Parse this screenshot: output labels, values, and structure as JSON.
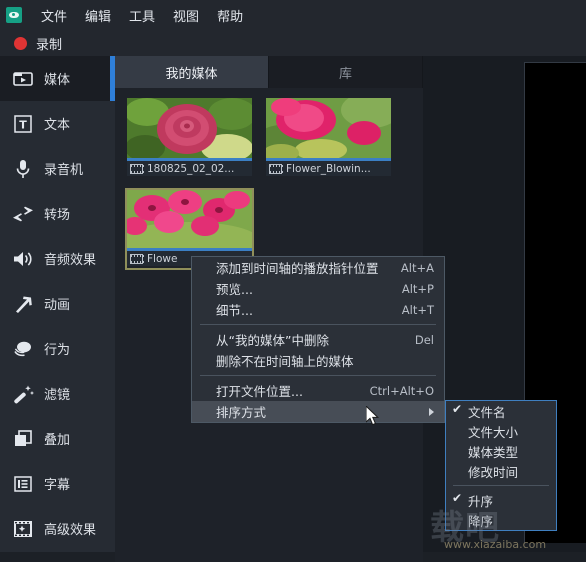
{
  "app": {
    "icon_name": "app-logo-icon",
    "accent_blue": "#2f7fd8",
    "record_red": "#e03434",
    "menu_bg": "#23272e",
    "panel_bg": "#1e2229",
    "selection_gold": "#8f8f5a"
  },
  "menubar": {
    "items": [
      {
        "label": "文件",
        "name": "menu-file"
      },
      {
        "label": "编辑",
        "name": "menu-edit"
      },
      {
        "label": "工具",
        "name": "menu-tools"
      },
      {
        "label": "视图",
        "name": "menu-view"
      },
      {
        "label": "帮助",
        "name": "menu-help"
      }
    ]
  },
  "record": {
    "label": "录制"
  },
  "sidebar": {
    "items": [
      {
        "label": "媒体",
        "icon": "media-folder-icon",
        "active": true
      },
      {
        "label": "文本",
        "icon": "text-icon",
        "active": false
      },
      {
        "label": "录音机",
        "icon": "microphone-icon",
        "active": false
      },
      {
        "label": "转场",
        "icon": "transition-arrows-icon",
        "active": false
      },
      {
        "label": "音频效果",
        "icon": "speaker-icon",
        "active": false
      },
      {
        "label": "动画",
        "icon": "arrow-up-right-icon",
        "active": false
      },
      {
        "label": "行为",
        "icon": "behaviors-icon",
        "active": false
      },
      {
        "label": "滤镜",
        "icon": "magic-wand-icon",
        "active": false
      },
      {
        "label": "叠加",
        "icon": "layers-icon",
        "active": false
      },
      {
        "label": "字幕",
        "icon": "captions-icon",
        "active": false
      },
      {
        "label": "高级效果",
        "icon": "advanced-effects-icon",
        "active": false
      }
    ]
  },
  "tabs": [
    {
      "label": "我的媒体",
      "name": "tab-my-media",
      "active": true
    },
    {
      "label": "库",
      "name": "tab-library",
      "active": false
    }
  ],
  "media": {
    "items": [
      {
        "filename": "180825_02_02...",
        "icon": "filmstrip-icon",
        "selected": false
      },
      {
        "filename": "Flower_Blowin...",
        "icon": "filmstrip-icon",
        "selected": false
      },
      {
        "filename": "Flowe",
        "icon": "filmstrip-icon",
        "selected": true
      }
    ]
  },
  "context_menu": {
    "rows": [
      {
        "label": "添加到时间轴的播放指针位置",
        "shortcut": "Alt+A",
        "name": "ctx-add-to-timeline"
      },
      {
        "label": "预览...",
        "shortcut": "Alt+P",
        "name": "ctx-preview"
      },
      {
        "label": "细节...",
        "shortcut": "Alt+T",
        "name": "ctx-details"
      },
      {
        "label": "从“我的媒体”中删除",
        "shortcut": "Del",
        "name": "ctx-remove-from-my-media"
      },
      {
        "label": "删除不在时间轴上的媒体",
        "shortcut": "",
        "name": "ctx-remove-unused"
      },
      {
        "label": "打开文件位置...",
        "shortcut": "Ctrl+Alt+O",
        "name": "ctx-open-file-location"
      },
      {
        "label": "排序方式",
        "shortcut": "",
        "name": "ctx-sort-by",
        "highlighted": true,
        "has_submenu": true
      }
    ]
  },
  "submenu": {
    "rows": [
      {
        "label": "文件名",
        "checked": true,
        "name": "submenu-sort-filename"
      },
      {
        "label": "文件大小",
        "checked": false,
        "name": "submenu-sort-filesize"
      },
      {
        "label": "媒体类型",
        "checked": false,
        "name": "submenu-sort-mediatype"
      },
      {
        "label": "修改时间",
        "checked": false,
        "name": "submenu-sort-modified"
      },
      {
        "label": "升序",
        "checked": true,
        "name": "submenu-sort-ascending"
      },
      {
        "label": "降序",
        "checked": false,
        "name": "submenu-sort-descending"
      }
    ],
    "check_glyph": "✔"
  },
  "watermark": {
    "big": "载吧",
    "url": "www.xiazaiba.com"
  }
}
